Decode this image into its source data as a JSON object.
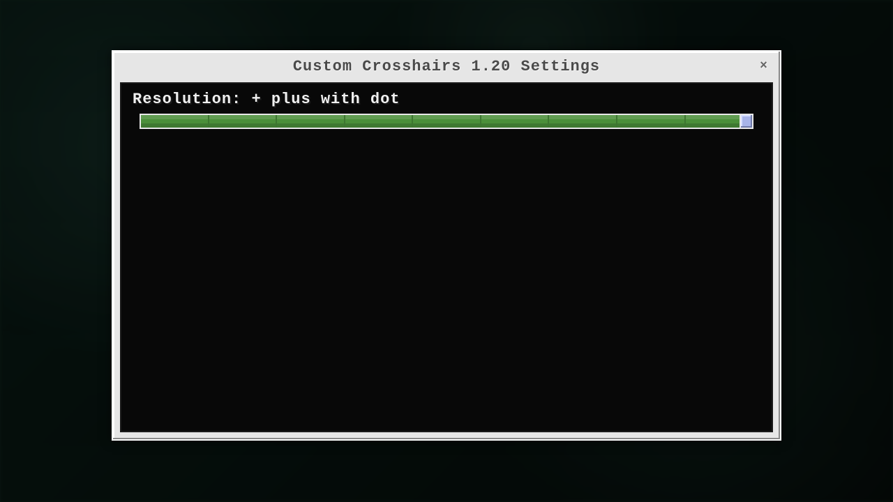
{
  "dialog": {
    "title": "Custom Crosshairs 1.20 Settings",
    "close_glyph": "×"
  },
  "resolution": {
    "label_prefix": "Resolution: ",
    "value_text": "+ plus with dot",
    "ticks": 9,
    "position_percent": 100
  },
  "colors": {
    "slider_fill": "#4b8f3a",
    "slider_thumb": "#a8b4e8",
    "panel_bg": "#080808",
    "dialog_bg": "#e6e6e6"
  }
}
